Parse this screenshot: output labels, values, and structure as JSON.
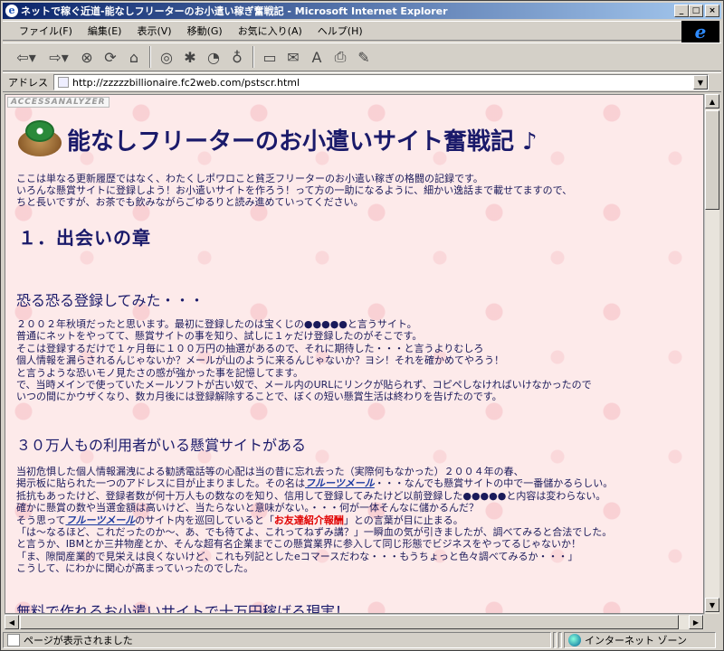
{
  "window": {
    "title": "ネットで稼ぐ近道-能なしフリーターのお小遣い稼ぎ奮戦記 - Microsoft Internet Explorer",
    "buttons": {
      "minimize": "_",
      "maximize": "□",
      "close": "×"
    }
  },
  "menu": [
    "ファイル(F)",
    "編集(E)",
    "表示(V)",
    "移動(G)",
    "お気に入り(A)",
    "ヘルプ(H)"
  ],
  "address": {
    "label": "アドレス",
    "url": "http://zzzzzbillionaire.fc2web.com/pstscr.html"
  },
  "page": {
    "badge": "ACCESSANALYZER",
    "title": "能なしフリーターのお小遣いサイト奮戦記 ♪",
    "intro": [
      "ここは単なる更新履歴ではなく、わたくしポワロこと貧乏フリーターのお小遣い稼ぎの格闘の記録です。",
      "いろんな懸賞サイトに登録しよう！お小遣いサイトを作ろう！って方の一助になるように、細かい逸話まで載せてますので、",
      "ちと長いですが、お茶でも飲みながらごゆるりと読み進めていってください。"
    ],
    "chapter": "１．出会いの章",
    "sections": [
      {
        "heading": "恐る恐る登録してみた・・・",
        "lines": [
          "２００２年秋頃だったと思います。最初に登録したのは宝くじの●●●●●と言うサイト。",
          "普通にネットをやってて、懸賞サイトの事を知り、試しに１ヶだけ登録したのがそこです。",
          "そこは登録するだけで１ヶ月毎に１００万円の抽選があるので、それに期待した・・・と言うよりむしろ",
          "個人情報を漏らされるんじゃないか？メールが山のように来るんじゃないか？ヨシ！それを確かめてやろう！",
          "と言うような恐いモノ見たさの感が強かった事を記憶してます。",
          "で、当時メインで使っていたメールソフトが古い奴で、メール内のURLにリンクが貼られず、コピペしなければいけなかったので",
          "いつの間にかウザくなり、数カ月後には登録解除することで、ぼくの短い懸賞生活は終わりを告げたのです。"
        ]
      },
      {
        "heading": "３０万人もの利用者がいる懸賞サイトがある",
        "line1": "当初危惧した個人情報漏洩による勧誘電話等の心配は当の昔に忘れ去った（実際何もなかった）２００４年の春、",
        "line2a": "掲示板に貼られた一つのアドレスに目が止まりました。その名は",
        "link": "フルーツメール",
        "line2b": "・・・なんでも懸賞サイトの中で一番儲かるらしい。",
        "line3": "抵抗もあったけど、登録者数が何十万人もの数なのを知り、信用して登録してみたけど以前登録した●●●●●と内容は変わらない。",
        "line4": "確かに懸賞の数や当選金額は高いけど、当たらないと意味がない。・・・何が一体そんなに儲かるんだ？",
        "line5a": "そう思って",
        "line5b": "のサイト内を巡回していると「",
        "red": "お友達紹介報酬",
        "line5c": "」との言葉が目に止まる。",
        "line6": "「は～なるほど、これだったのか～、あ、でも待てよ、これってねずみ講？」一瞬血の気が引きましたが、調べてみると合法でした。",
        "line7": "と言うか、IBMとか三井物産とか、そんな超有名企業までこの懸賞業界に参入して同じ形態でビジネスをやってるじゃないか！",
        "line8": "「ま、隙間産業的で見栄えは良くないけど、これも列記としたeコマースだわな・・・もうちょっと色々調べてみるか・・・」",
        "line9": "こうして、にわかに関心が高まっていったのでした。"
      },
      {
        "heading": "無料で作れるお小遣いサイトで十万円稼げる現実！"
      }
    ]
  },
  "status": {
    "text": "ページが表示されました",
    "zone": "インターネット ゾーン"
  },
  "icons": {
    "back": "arrow-left-icon",
    "forward": "arrow-right-icon",
    "stop": "stop-icon",
    "refresh": "refresh-icon",
    "home": "home-icon",
    "search": "search-icon",
    "favorites": "favorites-icon",
    "history": "history-icon",
    "channels": "channels-icon",
    "fullscreen": "fullscreen-icon",
    "mail": "mail-icon",
    "font": "font-icon",
    "print": "print-icon",
    "edit": "edit-icon"
  }
}
